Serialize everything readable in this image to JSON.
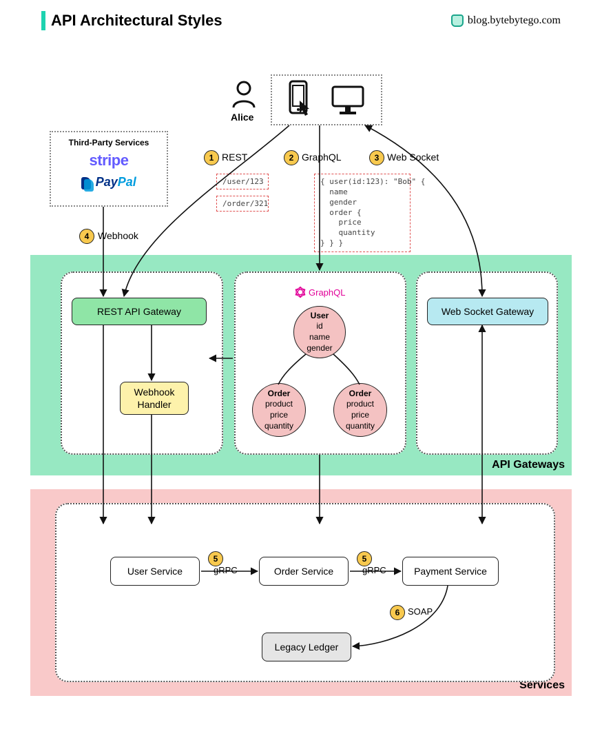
{
  "header": {
    "title": "API Architectural Styles",
    "blog": "blog.bytebytego.com"
  },
  "alice_label": "Alice",
  "third_party": {
    "title": "Third-Party Services",
    "stripe": "stripe",
    "paypal_pay": "Pay",
    "paypal_pal": "Pal"
  },
  "steps": {
    "s1": {
      "num": "1",
      "label": "REST"
    },
    "s2": {
      "num": "2",
      "label": "GraphQL"
    },
    "s3": {
      "num": "3",
      "label": "Web Socket"
    },
    "s4": {
      "num": "4",
      "label": "Webhook"
    },
    "s5a": {
      "num": "5",
      "label": "gRPC"
    },
    "s5b": {
      "num": "5",
      "label": "gRPC"
    },
    "s6": {
      "num": "6",
      "label": "SOAP"
    }
  },
  "rest_endpoints": {
    "user": "/user/123",
    "order": "/order/321"
  },
  "graphql_query": "{ user(id:123): \"Bob\" {\n  name\n  gender\n  order {\n    price\n    quantity\n} } }",
  "gateways": {
    "rest": "REST API Gateway",
    "webhook": "Webhook\nHandler",
    "websocket": "Web Socket Gateway",
    "graphql_name": "GraphQL"
  },
  "graphql_schema": {
    "user": {
      "title": "User",
      "f1": "id",
      "f2": "name",
      "f3": "gender"
    },
    "order1": {
      "title": "Order",
      "f1": "product",
      "f2": "price",
      "f3": "quantity"
    },
    "order2": {
      "title": "Order",
      "f1": "product",
      "f2": "price",
      "f3": "quantity"
    }
  },
  "band_labels": {
    "gateways": "API Gateways",
    "services": "Services"
  },
  "services": {
    "user": "User Service",
    "order": "Order Service",
    "payment": "Payment Service",
    "legacy": "Legacy Ledger"
  }
}
